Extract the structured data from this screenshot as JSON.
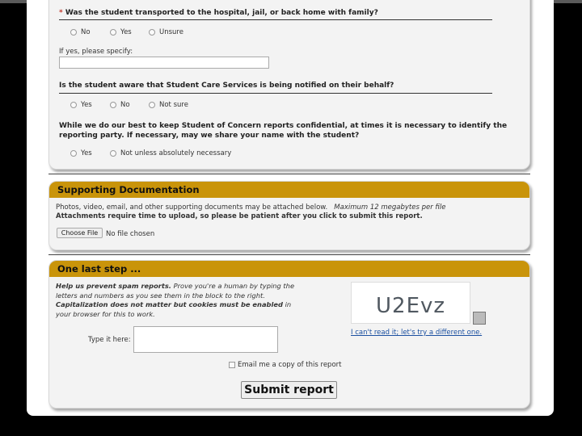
{
  "section1": {
    "q1": {
      "required_mark": "*",
      "text": "Was the student transported to the hospital, jail, or back home with family?",
      "options": [
        "No",
        "Yes",
        "Unsure"
      ]
    },
    "specify_label": "If yes, please specify:",
    "specify_value": "",
    "q2": {
      "text": "Is the student aware that Student Care Services is being notified on their behalf?",
      "options": [
        "Yes",
        "No",
        "Not sure"
      ]
    },
    "q3": {
      "text_line1": "While we do our best to keep Student of Concern reports confidential, at times it is necessary to identify the",
      "text_line2": "reporting party. If necessary, may we share your name with the student?",
      "options": [
        "Yes",
        "Not unless absolutely necessary"
      ]
    }
  },
  "section2": {
    "title": "Supporting Documentation",
    "line1": "Photos, video, email, and other supporting documents may be attached below.",
    "line1_italic": "Maximum 12 megabytes per file",
    "line2": "Attachments require time to upload, so please be patient after you click to submit this report.",
    "file_button": "Choose File",
    "file_status": "No file chosen"
  },
  "section3": {
    "title": "One last step ...",
    "spam_bold": "Help us prevent spam reports.",
    "spam_text": "Prove you're a human by typing the letters and numbers as you see them in the block to the right.",
    "spam_bold2": "Capitalization does not matter but cookies must be enabled",
    "spam_text2": "in your browser for this to work.",
    "captcha_text": "U2Evz",
    "captcha_link": "I can't read it; let's try a different one.",
    "type_label": "Type it here:",
    "type_value": "",
    "email_copy_label": "Email me a copy of this report",
    "submit_label": "Submit report"
  }
}
